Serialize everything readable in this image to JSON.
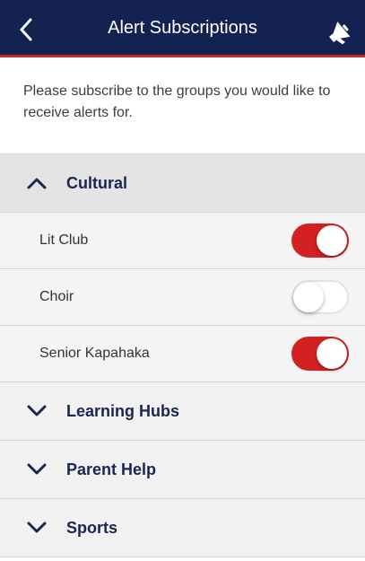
{
  "navbar": {
    "title": "Alert Subscriptions",
    "back_icon": "chevron-left-icon",
    "action_icon": "megaphone-icon"
  },
  "intro_text": "Please subscribe to the groups you would like to receive alerts for.",
  "colors": {
    "navbar_bg": "#142252",
    "navbar_accent": "#c62828",
    "toggle_on": "#d32020",
    "group_label": "#1a2550"
  },
  "groups": [
    {
      "label": "Cultural",
      "expanded": true,
      "items": [
        {
          "label": "Lit Club",
          "subscribed": true
        },
        {
          "label": "Choir",
          "subscribed": false
        },
        {
          "label": "Senior Kapahaka",
          "subscribed": true
        }
      ]
    },
    {
      "label": "Learning Hubs",
      "expanded": false
    },
    {
      "label": "Parent Help",
      "expanded": false
    },
    {
      "label": "Sports",
      "expanded": false
    }
  ]
}
